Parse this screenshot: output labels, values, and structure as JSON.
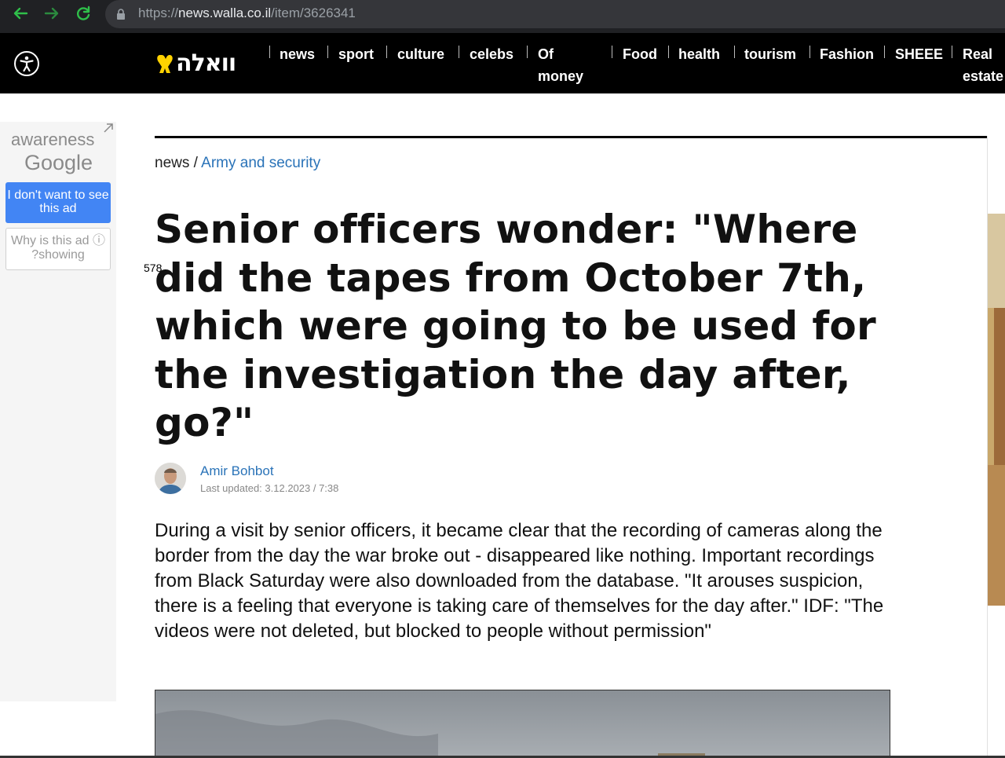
{
  "browser": {
    "url_scheme": "https://",
    "url_host": "news.walla.co.il",
    "url_path": "/item/3626341"
  },
  "site": {
    "logo_text": "וואלה",
    "nav": [
      {
        "label": "news"
      },
      {
        "label": "sport"
      },
      {
        "label": "culture"
      },
      {
        "label": "celebs"
      },
      {
        "label_line1": "Of",
        "label_line2": "money"
      },
      {
        "label": "Food"
      },
      {
        "label": "health"
      },
      {
        "label": "tourism"
      },
      {
        "label": "Fashion"
      },
      {
        "label": "SHEEE"
      },
      {
        "label_line1": "Real",
        "label_line2": "estate"
      }
    ]
  },
  "ad": {
    "awareness": "awareness",
    "google": "Google",
    "dont_want": "I don't want to see this ad",
    "why": "Why is this ad ⓘ ?showing"
  },
  "article": {
    "breadcrumb_section": "news",
    "breadcrumb_separator": " / ",
    "breadcrumb_category": "Army and security",
    "view_count": "578",
    "headline": "Senior officers wonder: \"Where did the tapes from October 7th, which were going to be used for the investigation the day after, go?\"",
    "author": "Amir Bohbot",
    "updated": "Last updated: 3.12.2023 / 7:38",
    "lead": "During a visit by senior officers, it became clear that the recording of cameras along the border from the day the war broke out - disappeared like nothing. Important recordings from Black Saturday were also downloaded from the database. \"It arouses suspicion, there is a feeling that everyone is taking care of themselves for the day after.\" IDF: \"The videos were not deleted, but blocked to people without permission\""
  },
  "colors": {
    "link_blue": "#2a73b8",
    "header_bg": "#000000",
    "chrome_bg": "#202124",
    "ad_button_blue": "#4285f4",
    "logo_yellow": "#ffd200"
  },
  "icons": [
    "back-arrow-icon",
    "forward-arrow-icon",
    "reload-icon",
    "lock-icon",
    "accessibility-icon",
    "ad-arrow-icon"
  ]
}
